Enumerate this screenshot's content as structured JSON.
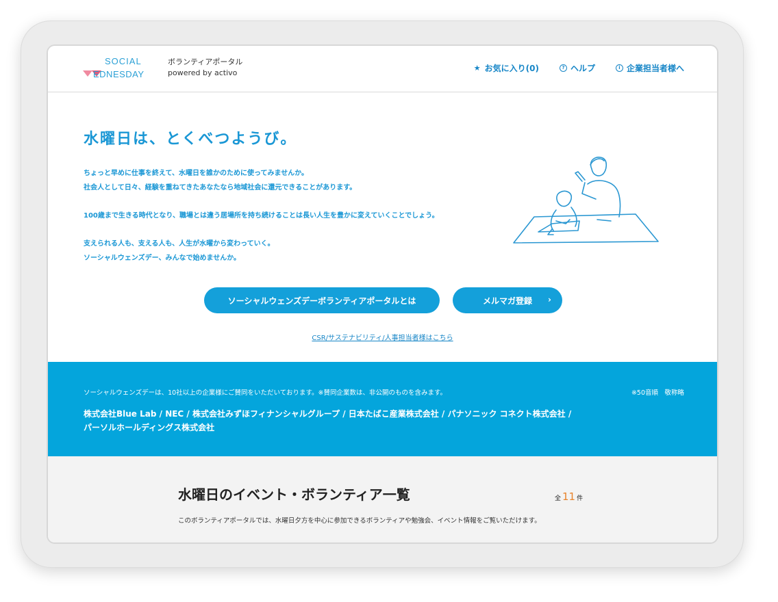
{
  "header": {
    "logo_line1": "SOCIAL",
    "logo_line2": "EDNESDAY",
    "subtitle_line1": "ボランティアポータル",
    "subtitle_line2": "powered by activo",
    "nav": [
      {
        "label": "お気に入り(0)",
        "icon": "star-icon"
      },
      {
        "label": "ヘルプ",
        "icon": "help-icon"
      },
      {
        "label": "企業担当者様へ",
        "icon": "info-icon"
      }
    ]
  },
  "hero": {
    "title": "水曜日は、とくべつようび。",
    "paragraphs": [
      [
        "ちょっと早めに仕事を終えて、水曜日を誰かのために使ってみませんか。",
        "社会人として日々、経験を重ねてきたあなたなら地域社会に還元できることがあります。"
      ],
      [
        "100歳まで生きる時代となり、職場とは違う居場所を持ち続けることは長い人生を豊かに変えていくことでしょう。"
      ],
      [
        "支えられる人も、支える人も、人生が水曜から変わっていく。",
        "ソーシャルウェンズデー、みんなで始めませんか。"
      ]
    ],
    "btn_about": "ソーシャルウェンズデーボランティアポータルとは",
    "btn_mail": "メルマガ登録",
    "btn_mail_chevron": "›",
    "csr_link": "CSR/サステナビリティ/人事担当者様はこちら"
  },
  "band": {
    "note": "ソーシャルウェンズデーは、10社以上の企業様にご賛同をいただいております。※賛同企業数は、非公開のものを含みます。",
    "sort": "※50音順　敬称略",
    "companies_line1": "株式会社Blue Lab / NEC / 株式会社みずほフィナンシャルグループ / 日本たばこ産業株式会社 / パナソニック コネクト株式会社 /",
    "companies_line2": "パーソルホールディングス株式会社"
  },
  "list": {
    "title": "水曜日のイベント・ボランティア一覧",
    "count_prefix": "全",
    "count": "11",
    "count_suffix": "件",
    "description": "このボランティアポータルでは、水曜日夕方を中心に参加できるボランティアや勉強会、イベント情報をご覧いただけます。"
  },
  "colors": {
    "accent": "#14a0da",
    "band": "#04a5dc",
    "count": "#e8832b"
  }
}
